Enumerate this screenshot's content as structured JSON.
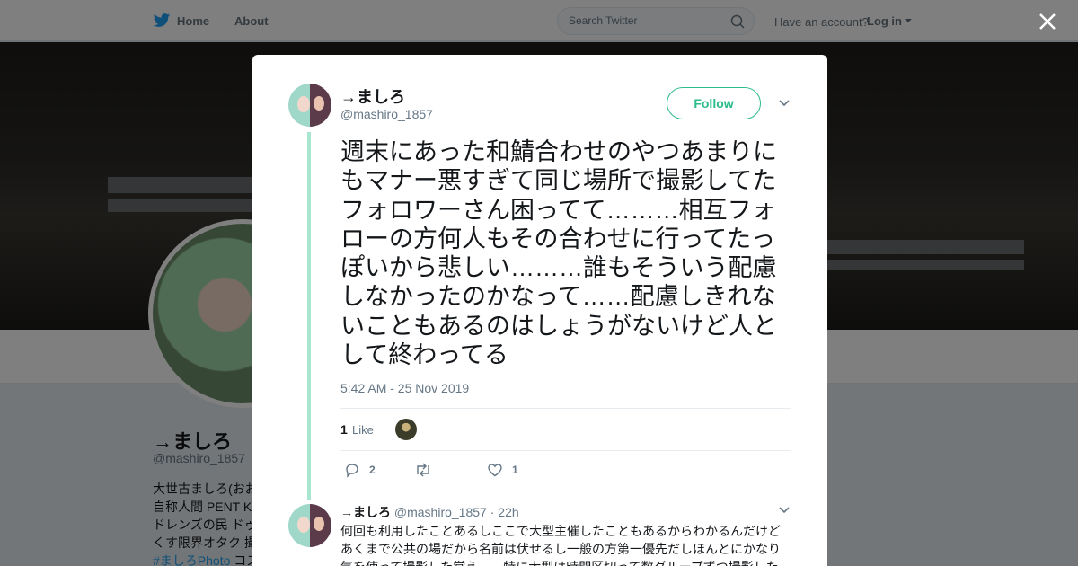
{
  "nav": {
    "home": "Home",
    "about": "About",
    "search_placeholder": "Search Twitter",
    "have_account": "Have an account?",
    "login": "Log in"
  },
  "profile": {
    "name": "→ましろ",
    "handle": "@mashiro_1857",
    "bio_lines": [
      "大世古ましろ(おお",
      "自称人間 PENT K",
      "ドレンズの民 ドゥ",
      "くす限界オタク 撮"
    ],
    "bio_hashtag": "#ましろPhoto",
    "bio_hashtag_suffix": " コス"
  },
  "tweet": {
    "author_name": "→ましろ",
    "author_handle": "@mashiro_1857",
    "follow_label": "Follow",
    "text": "週末にあった和鯖合わせのやつあまりにもマナー悪すぎて同じ場所で撮影してたフォロワーさん困ってて………相互フォローの方何人もその合わせに行ってたっぽいから悲しい………誰もそういう配慮しなかったのかなって……配慮しきれないこともあるのはしょうがないけど人として終わってる",
    "timestamp": "5:42 AM - 25 Nov 2019",
    "likes_count": "1",
    "likes_label": "Like",
    "replies": "2",
    "retweets": "",
    "likes": "1"
  },
  "reply": {
    "name": "→ましろ",
    "handle": "@mashiro_1857",
    "separator": "·",
    "time": "22h",
    "text": "何回も利用したことあるしここで大型主催したこともあるからわかるんだけどあくまで公共の場だから名前は伏せるし一般の方第一優先だしほんとにかなり気を使って撮影した覚え……特に大型は時間区切って数グループずつ撮影した"
  },
  "colors": {
    "accent": "#2bbc8a",
    "thread_line": "#a8e6cf",
    "brand": "#1da1f2"
  }
}
